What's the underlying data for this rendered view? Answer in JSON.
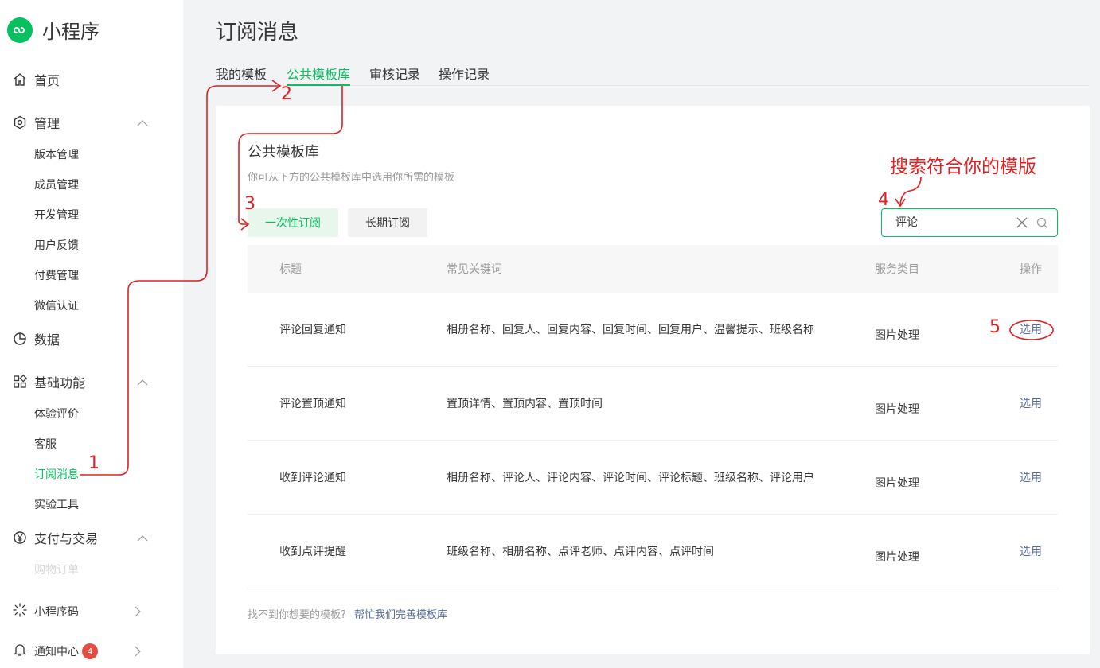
{
  "app": {
    "name": "小程序"
  },
  "sidebar": {
    "home": "首页",
    "manage": "管理",
    "manage_items": [
      "版本管理",
      "成员管理",
      "开发管理",
      "用户反馈",
      "付费管理",
      "微信认证"
    ],
    "data": "数据",
    "basic": "基础功能",
    "basic_items": [
      "体验评价",
      "客服",
      "订阅消息",
      "实验工具"
    ],
    "pay": "支付与交易",
    "pay_items": [
      "购物订单"
    ],
    "qrcode": "小程序码",
    "notify": "通知中心",
    "notify_badge": "4"
  },
  "page": {
    "title": "订阅消息"
  },
  "tabs": [
    "我的模板",
    "公共模板库",
    "审核记录",
    "操作记录"
  ],
  "card": {
    "title": "公共模板库",
    "desc": "你可从下方的公共模板库中选用你所需的模板",
    "segments": [
      "一次性订阅",
      "长期订阅"
    ],
    "search_value": "评论"
  },
  "table": {
    "headers": [
      "标题",
      "常见关键词",
      "服务类目",
      "操作"
    ],
    "rows": [
      {
        "title": "评论回复通知",
        "keywords": "相册名称、回复人、回复内容、回复时间、回复用户、温馨提示、班级名称",
        "category": "图片处理",
        "action": "选用"
      },
      {
        "title": "评论置顶通知",
        "keywords": "置顶详情、置顶内容、置顶时间",
        "category": "图片处理",
        "action": "选用"
      },
      {
        "title": "收到评论通知",
        "keywords": "相册名称、评论人、评论内容、评论时间、评论标题、班级名称、评论用户",
        "category": "图片处理",
        "action": "选用"
      },
      {
        "title": "收到点评提醒",
        "keywords": "班级名称、相册名称、点评老师、点评内容、点评时间",
        "category": "图片处理",
        "action": "选用"
      }
    ]
  },
  "footer": {
    "text": "找不到你想要的模板?",
    "link": "帮忙我们完善模板库"
  },
  "annotations": {
    "steps": [
      "1",
      "2",
      "3",
      "4",
      "5"
    ],
    "search_hint": "搜索符合你的模版",
    "color": "#e02020"
  },
  "colors": {
    "accent": "#07c160",
    "link": "#576b95",
    "badge": "#e54d42"
  }
}
